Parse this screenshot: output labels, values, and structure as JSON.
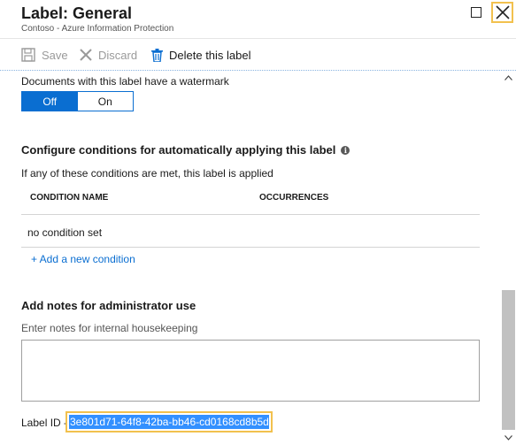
{
  "header": {
    "title": "Label: General",
    "subtitle": "Contoso - Azure Information Protection"
  },
  "toolbar": {
    "save_label": "Save",
    "discard_label": "Discard",
    "delete_label": "Delete this label"
  },
  "watermark": {
    "label": "Documents with this label have a watermark",
    "options": [
      "Off",
      "On"
    ],
    "selected": "Off"
  },
  "conditions": {
    "title": "Configure conditions for automatically applying this label",
    "description": "If any of these conditions are met, this label is applied",
    "columns": [
      "CONDITION NAME",
      "OCCURRENCES"
    ],
    "rows": [
      {
        "name": "no condition set",
        "occurrences": ""
      }
    ],
    "add_link": "+ Add a new condition"
  },
  "notes": {
    "title": "Add notes for administrator use",
    "description": "Enter notes for internal housekeeping",
    "value": ""
  },
  "label_id": {
    "prefix": "Label ID -",
    "value": "3e801d71-64f8-42ba-bb46-cd0168cd8b5d"
  },
  "colors": {
    "accent": "#0a6ed1",
    "focus_outline": "#f2c14e",
    "selection": "#3390ff"
  }
}
